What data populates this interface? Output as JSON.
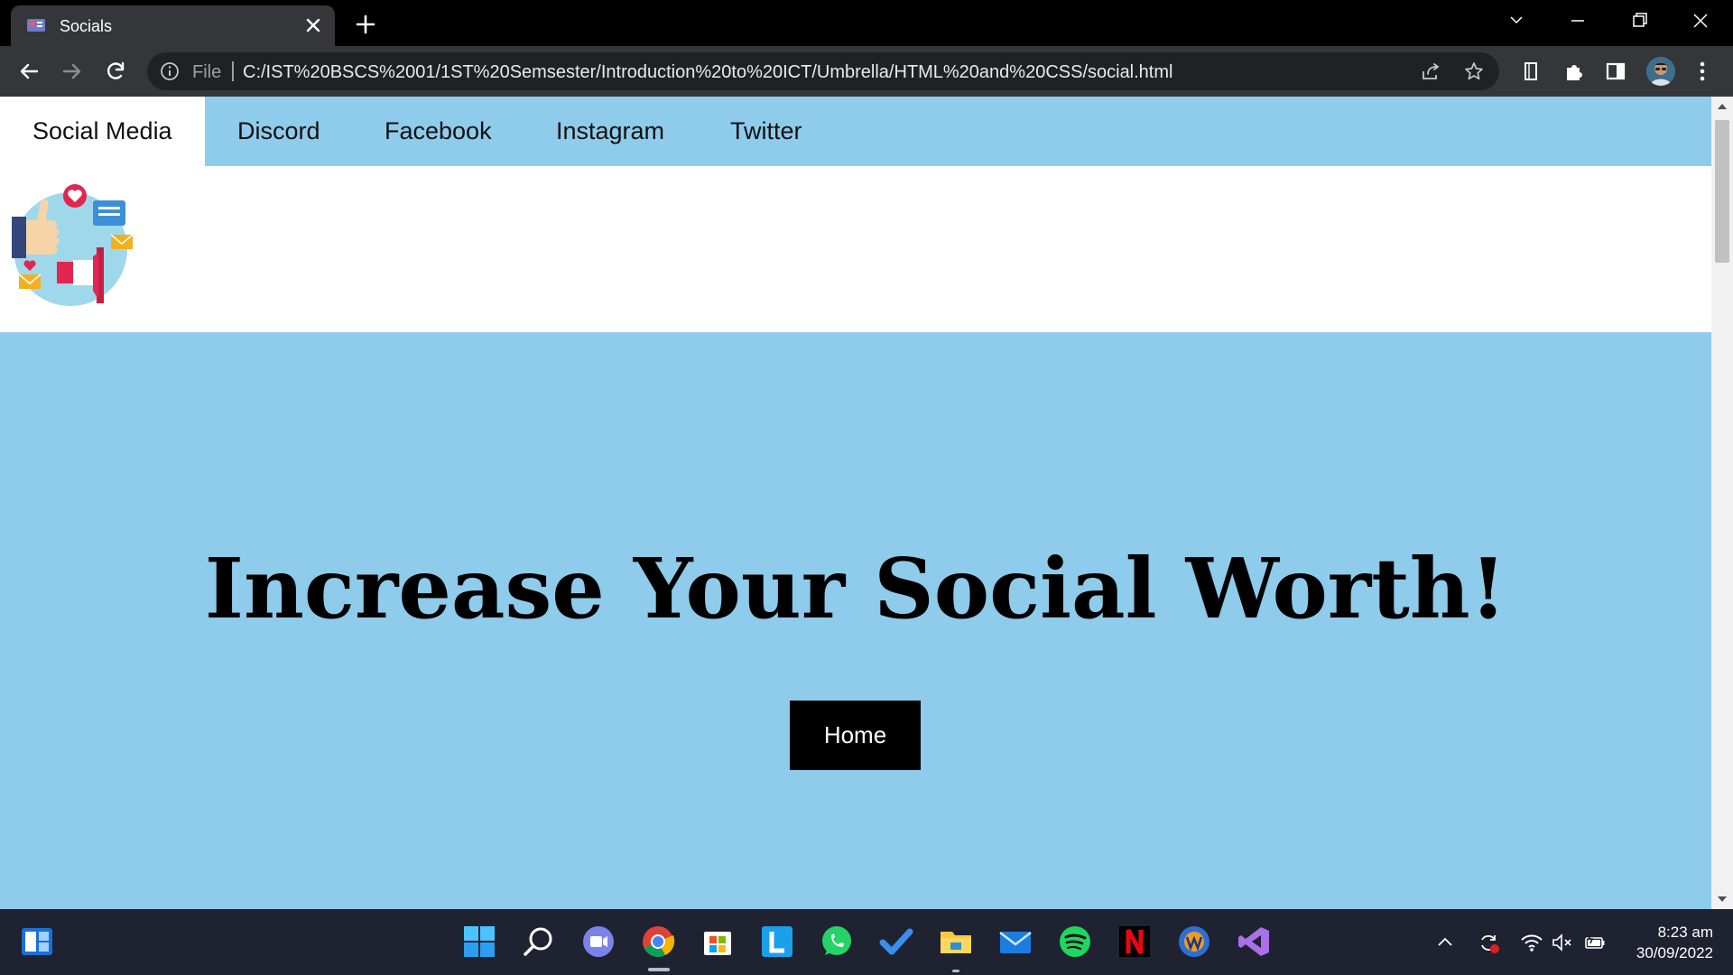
{
  "browser": {
    "tab_title": "Socials",
    "omnibox": {
      "scheme_label": "File",
      "url": "C:/IST%20BSCS%2001/1ST%20Semsester/Introduction%20to%20ICT/Umbrella/HTML%20and%20CSS/social.html"
    }
  },
  "page": {
    "nav": {
      "items": [
        {
          "label": "Social Media"
        },
        {
          "label": "Discord"
        },
        {
          "label": "Facebook"
        },
        {
          "label": "Instagram"
        },
        {
          "label": "Twitter"
        }
      ]
    },
    "hero": {
      "title": "Increase Your Social Worth!",
      "button_label": "Home"
    }
  },
  "taskbar": {
    "clock": {
      "time": "8:23 am",
      "date": "30/09/2022"
    }
  },
  "colors": {
    "nav_bg": "#8fcbea",
    "hero_bg": "#8fcbea",
    "button_bg": "#000000",
    "chrome_dark": "#35363a"
  }
}
